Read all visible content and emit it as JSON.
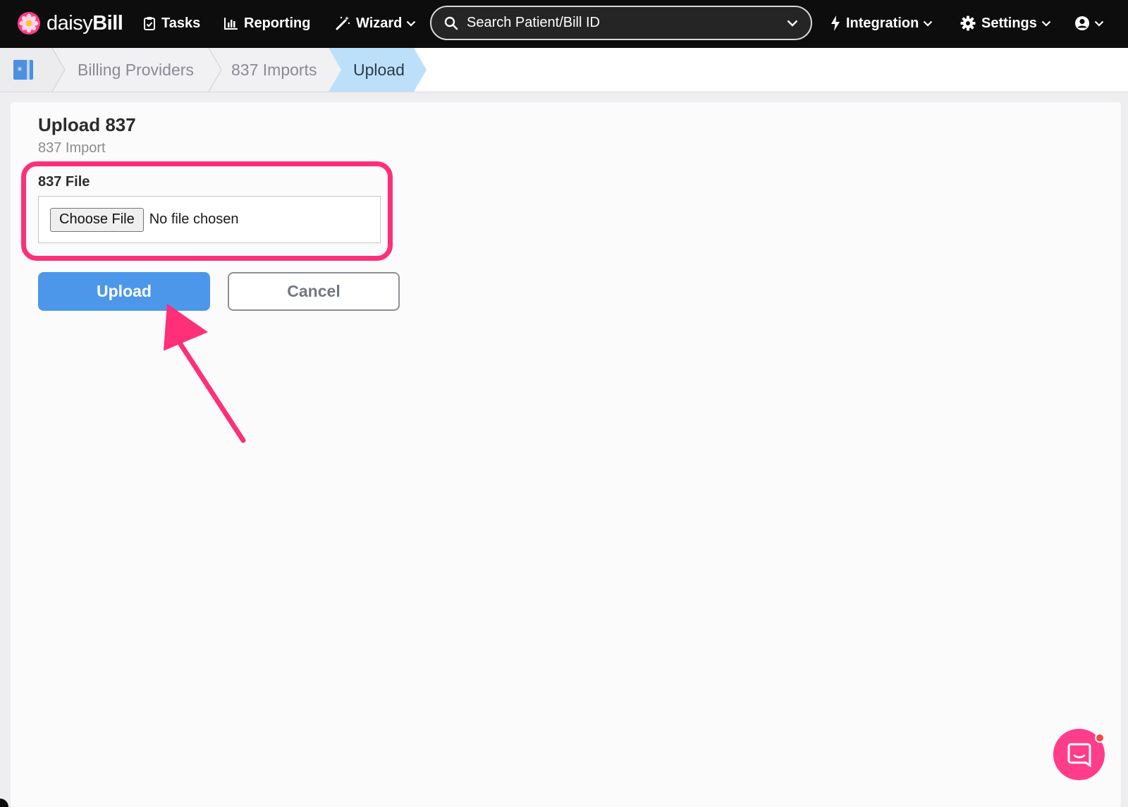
{
  "navbar": {
    "brand": {
      "part1": "daisy",
      "part2": "Bill"
    },
    "tasks_label": "Tasks",
    "reporting_label": "Reporting",
    "wizard_label": "Wizard",
    "search_placeholder": "Search Patient/Bill ID",
    "integration_label": "Integration",
    "settings_label": "Settings",
    "icons": [
      "daisy-logo-icon",
      "clipboard-check-icon",
      "bar-chart-icon",
      "magic-wand-icon",
      "search-icon",
      "chevron-down-icon",
      "bolt-icon",
      "gear-icon",
      "user-circle-icon"
    ]
  },
  "breadcrumb": {
    "items": [
      {
        "label": "Billing Providers"
      },
      {
        "label": "837 Imports"
      },
      {
        "label": "Upload",
        "active": true
      }
    ]
  },
  "page": {
    "title": "Upload 837",
    "subtitle": "837 Import",
    "file_field": {
      "label": "837 File",
      "button_label": "Choose File",
      "status_text": "No file chosen"
    },
    "upload_label": "Upload",
    "cancel_label": "Cancel"
  },
  "colors": {
    "navbar_bg": "#0d0d0e",
    "primary_button": "#4d97ea",
    "active_crumb": "#bde0fa",
    "annotation": "#ff2f78",
    "chat_launcher": "#ff3d8a"
  }
}
